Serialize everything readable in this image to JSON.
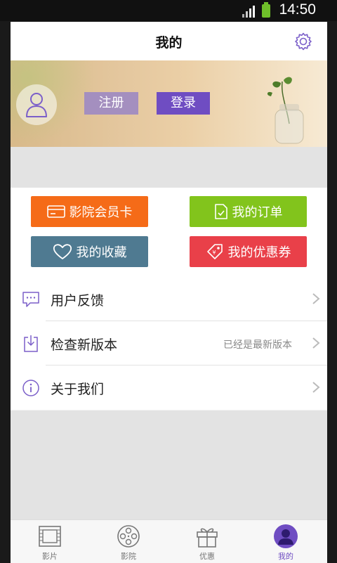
{
  "status_bar": {
    "time": "14:50"
  },
  "header": {
    "title": "我的"
  },
  "banner": {
    "register_label": "注册",
    "login_label": "登录"
  },
  "quick_actions": [
    {
      "label": "影院会员卡",
      "icon": "card-icon",
      "color": "#f56b18"
    },
    {
      "label": "我的订单",
      "icon": "order-icon",
      "color": "#82c41c"
    },
    {
      "label": "我的收藏",
      "icon": "heart-icon",
      "color": "#4f7a91"
    },
    {
      "label": "我的优惠券",
      "icon": "coupon-icon",
      "color": "#e94049"
    }
  ],
  "menu": [
    {
      "label": "用户反馈",
      "value": "",
      "icon": "feedback-icon"
    },
    {
      "label": "检查新版本",
      "value": "已经是最新版本",
      "icon": "download-icon"
    },
    {
      "label": "关于我们",
      "value": "",
      "icon": "info-icon"
    }
  ],
  "tabs": [
    {
      "label": "影片",
      "icon": "film-icon",
      "active": false
    },
    {
      "label": "影院",
      "icon": "film-reel-icon",
      "active": false
    },
    {
      "label": "优惠",
      "icon": "gift-icon",
      "active": false
    },
    {
      "label": "我的",
      "icon": "user-icon",
      "active": true
    }
  ],
  "colors": {
    "accent": "#6f4dc2",
    "register": "#a48fbf"
  }
}
